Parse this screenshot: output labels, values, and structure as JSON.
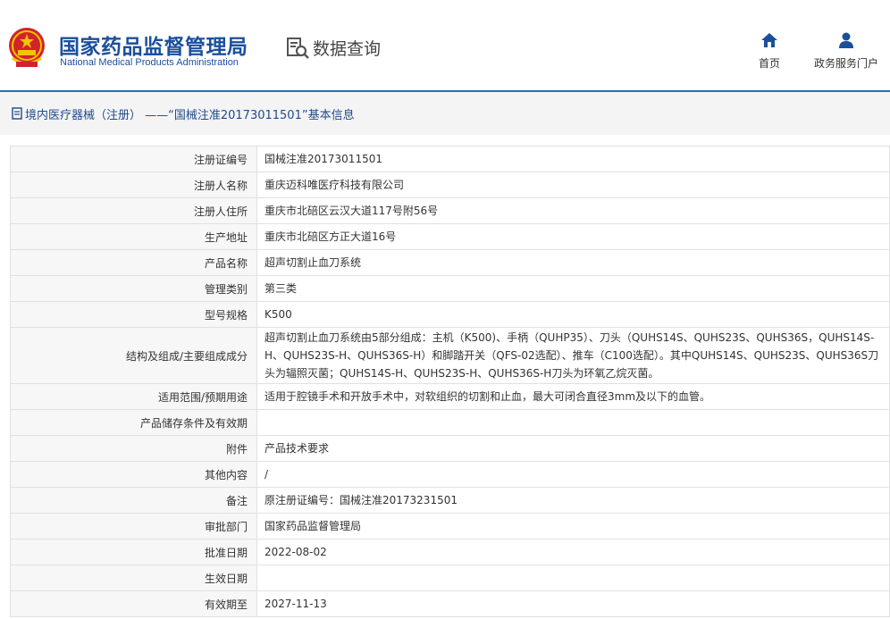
{
  "header": {
    "title": "国家药品监督管理局",
    "subtitle": "National Medical Products Administration",
    "data_query": "数据查询",
    "nav": [
      {
        "label": "首页",
        "icon": "home-icon"
      },
      {
        "label": "政务服务门户",
        "icon": "user-icon"
      }
    ]
  },
  "breadcrumb": {
    "text": "境内医疗器械（注册） ——“国械注准20173011501”基本信息"
  },
  "rows": [
    {
      "label": "注册证编号",
      "value": "国械注准20173011501"
    },
    {
      "label": "注册人名称",
      "value": "重庆迈科唯医疗科技有限公司"
    },
    {
      "label": "注册人住所",
      "value": "重庆市北碚区云汉大道117号附56号"
    },
    {
      "label": "生产地址",
      "value": "重庆市北碚区方正大道16号"
    },
    {
      "label": "产品名称",
      "value": "超声切割止血刀系统"
    },
    {
      "label": "管理类别",
      "value": "第三类"
    },
    {
      "label": "型号规格",
      "value": "K500"
    },
    {
      "label": "结构及组成/主要组成成分",
      "value": "超声切割止血刀系统由5部分组成：主机（K500)、手柄（QUHP35）、刀头（QUHS14S、QUHS23S、QUHS36S，QUHS14S-H、QUHS23S-H、QUHS36S-H）和脚踏开关（QFS-02选配）、推车（C100选配）。其中QUHS14S、QUHS23S、QUHS36S刀头为辐照灭菌；QUHS14S-H、QUHS23S-H、QUHS36S-H刀头为环氧乙烷灭菌。"
    },
    {
      "label": "适用范围/预期用途",
      "value": "适用于腔镜手术和开放手术中，对软组织的切割和止血，最大可闭合直径3mm及以下的血管。"
    },
    {
      "label": "产品储存条件及有效期",
      "value": ""
    },
    {
      "label": "附件",
      "value": "产品技术要求"
    },
    {
      "label": "其他内容",
      "value": "/"
    },
    {
      "label": "备注",
      "value": "原注册证编号：国械注准20173231501"
    },
    {
      "label": "审批部门",
      "value": "国家药品监督管理局"
    },
    {
      "label": "批准日期",
      "value": "2022-08-02"
    },
    {
      "label": "生效日期",
      "value": ""
    },
    {
      "label": "有效期至",
      "value": "2027-11-13"
    }
  ]
}
